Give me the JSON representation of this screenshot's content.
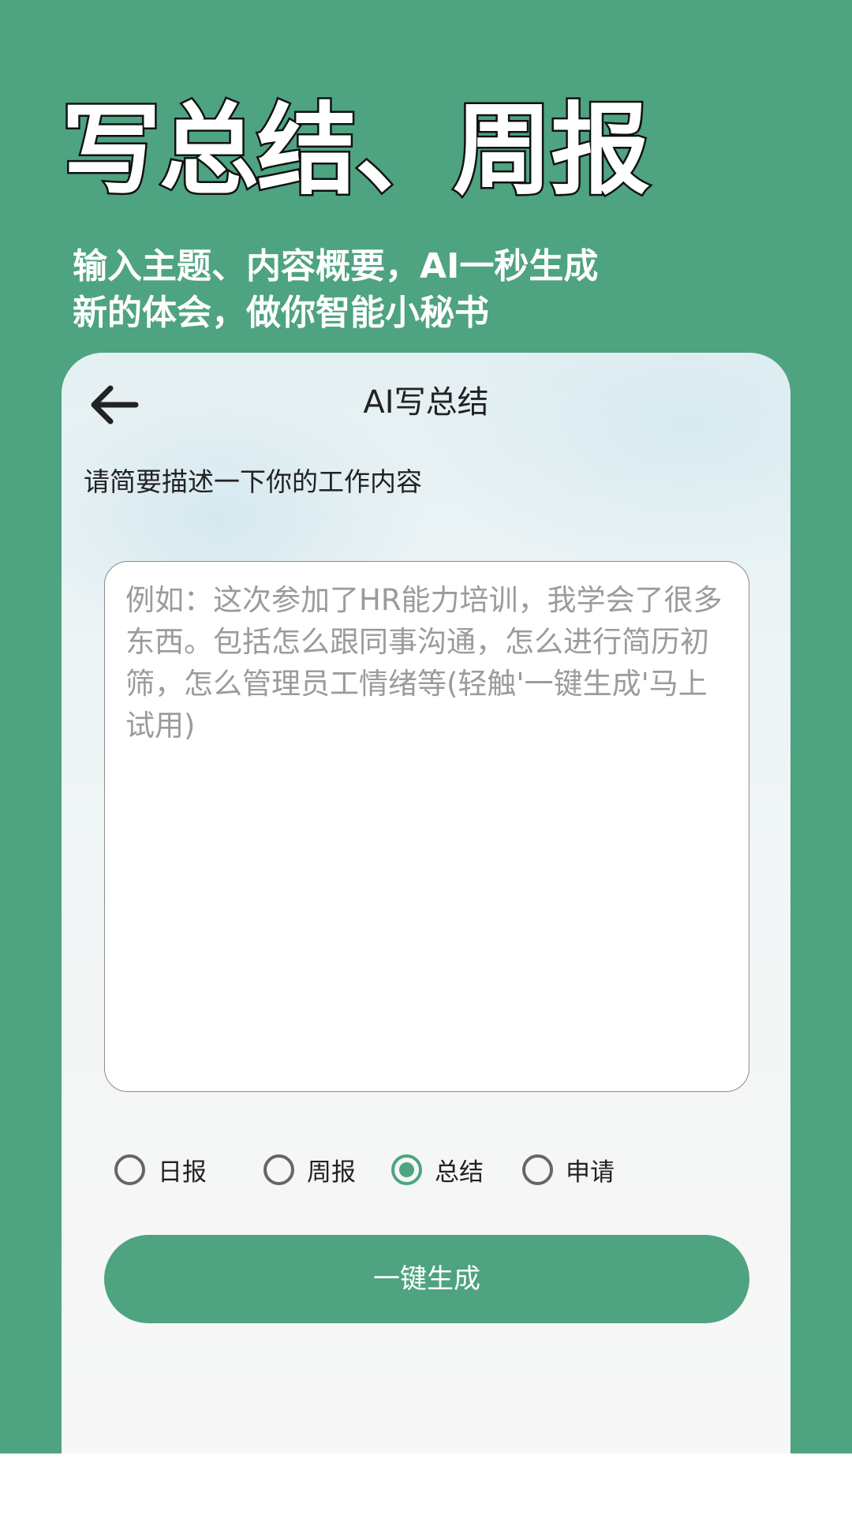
{
  "promo": {
    "headline": "写总结、周报",
    "subline_1": "输入主题、内容概要，AI一秒生成",
    "subline_2": "新的体会，做你智能小秘书"
  },
  "card": {
    "title": "AI写总结",
    "back_icon": "arrow-left-icon",
    "description_label": "请简要描述一下你的工作内容",
    "textarea": {
      "value": "",
      "placeholder": "例如：这次参加了HR能力培训，我学会了很多东西。包括怎么跟同事沟通，怎么进行简历初筛，怎么管理员工情绪等(轻触'一键生成'马上试用)"
    },
    "report_types": [
      {
        "label": "日报",
        "checked": false
      },
      {
        "label": "周报",
        "checked": false
      },
      {
        "label": "总结",
        "checked": true
      },
      {
        "label": "申请",
        "checked": false
      }
    ],
    "generate_button": "一键生成"
  },
  "colors": {
    "brand_green": "#4ea381",
    "text_dark": "#222222",
    "placeholder_gray": "#9b9b9b"
  }
}
